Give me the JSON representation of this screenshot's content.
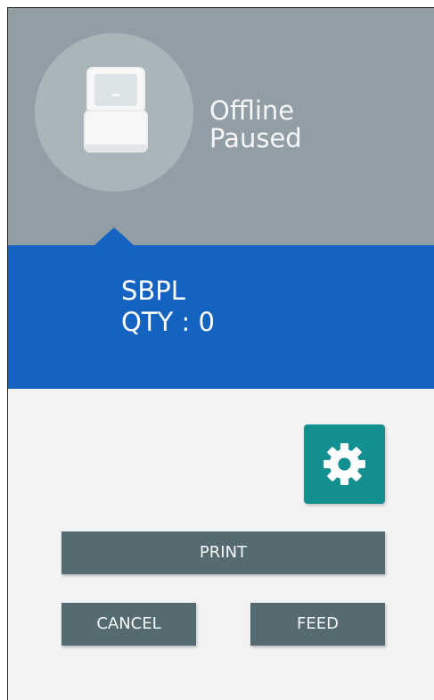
{
  "status": {
    "line1": "Offline",
    "line2": "Paused",
    "icon": "printer-icon"
  },
  "job": {
    "language": "SBPL",
    "quantity": "QTY : 0"
  },
  "settings": {
    "icon": "gear-icon"
  },
  "actions": {
    "print": "PRINT",
    "cancel": "CANCEL",
    "feed": "FEED"
  },
  "colors": {
    "header": "#919ea5",
    "circle": "#aab5bb",
    "info_band": "#1563c1",
    "settings_button": "#138f90",
    "action_button": "#566a71"
  }
}
